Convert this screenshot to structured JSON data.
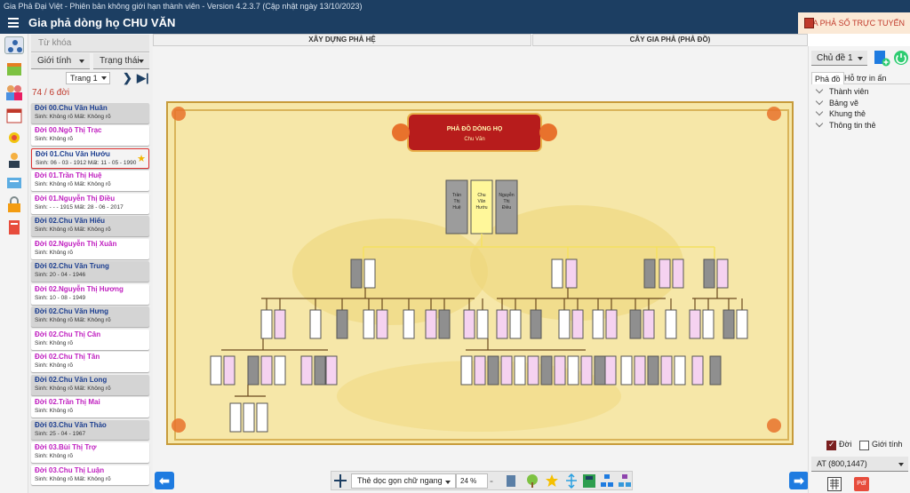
{
  "window": {
    "title": "Gia Phả Đại Việt - Phiên bản không giới hạn thành viên - Version 4.2.3.7 (Cập nhật ngày 13/10/2023)"
  },
  "app": {
    "title": "Gia phả dòng họ CHU VĂN",
    "online_button": "GIA PHẢ SỐ TRỰC TUYẾN"
  },
  "left": {
    "search_placeholder": "Từ khóa",
    "filter_gender": "Giới tính",
    "filter_status": "Trạng thái",
    "page_select": "Trang 1",
    "count": "74 / 6 đời",
    "cards": [
      {
        "name": "Đời 00.Chu Văn Huân",
        "detail": "Sinh: Không rõ   Mất: Không rõ",
        "gender": "male"
      },
      {
        "name": "Đời 00.Ngô Thị Trạc",
        "detail": "Sinh: Không rõ",
        "gender": "female"
      },
      {
        "name": "Đời 01.Chu Văn Hướu",
        "detail": "Sinh: 06 - 03 - 1912   Mất: 11 - 05 - 1990",
        "gender": "male",
        "selected": true
      },
      {
        "name": "Đời 01.Trần Thị Huệ",
        "detail": "Sinh: Không rõ   Mất: Không rõ",
        "gender": "female"
      },
      {
        "name": "Đời 01.Nguyễn Thị Điều",
        "detail": "Sinh: - - - 1915   Mất: 28 - 06 - 2017",
        "gender": "female"
      },
      {
        "name": "Đời 02.Chu Văn Hiếu",
        "detail": "Sinh: Không rõ   Mất: Không rõ",
        "gender": "male"
      },
      {
        "name": "Đời 02.Nguyễn Thị Xuân",
        "detail": "Sinh: Không rõ",
        "gender": "female"
      },
      {
        "name": "Đời 02.Chu Văn Trung",
        "detail": "Sinh: 20 - 04 - 1946",
        "gender": "male"
      },
      {
        "name": "Đời 02.Nguyễn Thị Hương",
        "detail": "Sinh: 10 - 08 - 1949",
        "gender": "female"
      },
      {
        "name": "Đời 02.Chu Văn Hưng",
        "detail": "Sinh: Không rõ   Mất: Không rõ",
        "gender": "male"
      },
      {
        "name": "Đời 02.Chu Thị Cân",
        "detail": "Sinh: Không rõ",
        "gender": "female"
      },
      {
        "name": "Đời 02.Chu Thị Tân",
        "detail": "Sinh: Không rõ",
        "gender": "female"
      },
      {
        "name": "Đời 02.Chu Văn Long",
        "detail": "Sinh: Không rõ   Mất: Không rõ",
        "gender": "male"
      },
      {
        "name": "Đời 02.Trần Thị Mai",
        "detail": "Sinh: Không rõ",
        "gender": "female"
      },
      {
        "name": "Đời 03.Chu Văn Thảo",
        "detail": "Sinh: 25 - 04 - 1967",
        "gender": "male"
      },
      {
        "name": "Đời 03.Bùi Thị Trợ",
        "detail": "Sinh: Không rõ",
        "gender": "female"
      },
      {
        "name": "Đời 03.Chu Thị Luận",
        "detail": "Sinh: Không rõ   Mất: Không rõ",
        "gender": "female"
      }
    ]
  },
  "tabs": {
    "build": "XÂY DỰNG PHẢ HỆ",
    "tree": "CÂY GIA PHẢ (PHẢ ĐỒ)"
  },
  "chart": {
    "banner_title": "PHẢ ĐỒ DÒNG HỌ",
    "banner_sub": "Chu Văn",
    "root": [
      {
        "name": "Trần Thị Huệ",
        "gender": "female"
      },
      {
        "name": "Chu Văn Hướu",
        "gender": "male"
      },
      {
        "name": "Nguyễn Thị Điều",
        "gender": "female"
      }
    ]
  },
  "bottom": {
    "layout": "Thẻ dọc gọn chữ ngang",
    "zoom": "24 %"
  },
  "right": {
    "theme": "Chủ đề 1",
    "tab_chart": "Phả đồ",
    "tab_print": "Hỗ trợ in ấn",
    "sections": [
      "Thành viên",
      "Bảng vẽ",
      "Khung thẻ",
      "Thông tin thẻ"
    ],
    "chk_generation": "Đời",
    "chk_gender": "Giới tính",
    "paper": "AT (800,1447)",
    "pdf": "Pdf"
  },
  "colors": {
    "accent": "#1c3e62",
    "male": "#1c3e90",
    "female": "#c020c0",
    "board": "#f6e7a8",
    "frame": "#c79b3a"
  }
}
